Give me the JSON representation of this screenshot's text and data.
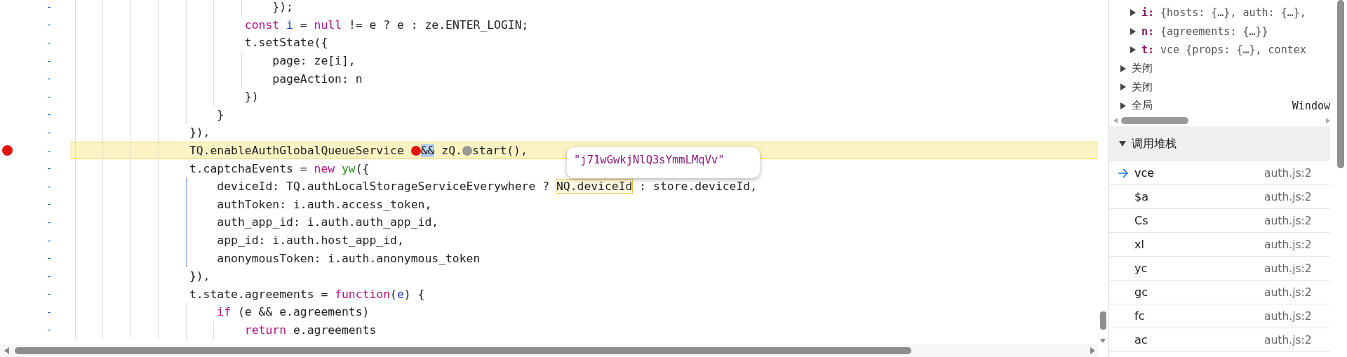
{
  "code": {
    "lines": [
      {
        "gutter": "-",
        "breakpoint": false,
        "paused": false,
        "active_guide": false,
        "tokens": [
          {
            "t": "                            });",
            "kind": "plain"
          }
        ]
      },
      {
        "gutter": "-",
        "breakpoint": false,
        "paused": false,
        "active_guide": false,
        "tokens": [
          {
            "t": "                        const",
            "kind": "keyword"
          },
          {
            "t": " i",
            "kind": "def"
          },
          {
            "t": " = ",
            "kind": "plain"
          },
          {
            "t": "null",
            "kind": "keyword"
          },
          {
            "t": " != e ? e : ze.ENTER_LOGIN;",
            "kind": "plain"
          }
        ]
      },
      {
        "gutter": "-",
        "breakpoint": false,
        "paused": false,
        "active_guide": false,
        "tokens": [
          {
            "t": "                        t.setState({",
            "kind": "plain"
          }
        ]
      },
      {
        "gutter": "-",
        "breakpoint": false,
        "paused": false,
        "active_guide": false,
        "tokens": [
          {
            "t": "                            page: ze[i],",
            "kind": "plain"
          }
        ]
      },
      {
        "gutter": "-",
        "breakpoint": false,
        "paused": false,
        "active_guide": false,
        "tokens": [
          {
            "t": "                            pageAction: n",
            "kind": "plain"
          }
        ]
      },
      {
        "gutter": "-",
        "breakpoint": false,
        "paused": false,
        "active_guide": false,
        "tokens": [
          {
            "t": "                        })",
            "kind": "plain"
          }
        ]
      },
      {
        "gutter": "-",
        "breakpoint": false,
        "paused": false,
        "active_guide": false,
        "tokens": [
          {
            "t": "                    }",
            "kind": "plain"
          }
        ]
      },
      {
        "gutter": "-",
        "breakpoint": false,
        "paused": false,
        "active_guide": false,
        "tokens": [
          {
            "t": "                }),",
            "kind": "plain"
          }
        ]
      },
      {
        "gutter": "-",
        "breakpoint": true,
        "paused": true,
        "active_guide": false,
        "tokens": [
          {
            "t": "                TQ.enableAuthGlobalQueueService ",
            "kind": "plain"
          },
          {
            "kind": "marker",
            "active": true
          },
          {
            "t": "&&",
            "kind": "plain",
            "selected": true
          },
          {
            "t": " zQ.",
            "kind": "plain"
          },
          {
            "kind": "marker",
            "active": false
          },
          {
            "t": "start(),",
            "kind": "plain"
          }
        ]
      },
      {
        "gutter": "-",
        "breakpoint": false,
        "paused": false,
        "active_guide": false,
        "tokens": [
          {
            "t": "                t.captchaEvents = ",
            "kind": "plain"
          },
          {
            "t": "new",
            "kind": "keyword"
          },
          {
            "t": " yw",
            "kind": "call"
          },
          {
            "t": "({",
            "kind": "plain"
          }
        ]
      },
      {
        "gutter": "-",
        "breakpoint": false,
        "paused": false,
        "active_guide": true,
        "tokens": [
          {
            "t": "                    deviceId: TQ.authLocalStorageServiceEverywhere ? ",
            "kind": "plain"
          },
          {
            "t": "NQ.deviceId",
            "kind": "plain",
            "hovered": true
          },
          {
            "t": " : store.deviceId,",
            "kind": "plain"
          }
        ]
      },
      {
        "gutter": "-",
        "breakpoint": false,
        "paused": false,
        "active_guide": true,
        "tokens": [
          {
            "t": "                    authToken: i.auth.access_token,",
            "kind": "plain"
          }
        ]
      },
      {
        "gutter": "-",
        "breakpoint": false,
        "paused": false,
        "active_guide": true,
        "tokens": [
          {
            "t": "                    auth_app_id: i.auth.auth_app_id,",
            "kind": "plain"
          }
        ]
      },
      {
        "gutter": "-",
        "breakpoint": false,
        "paused": false,
        "active_guide": true,
        "tokens": [
          {
            "t": "                    app_id: i.auth.host_app_id,",
            "kind": "plain"
          }
        ]
      },
      {
        "gutter": "-",
        "breakpoint": false,
        "paused": false,
        "active_guide": true,
        "tokens": [
          {
            "t": "                    anonymousToken: i.auth.anonymous_token",
            "kind": "plain"
          }
        ]
      },
      {
        "gutter": "-",
        "breakpoint": false,
        "paused": false,
        "active_guide": false,
        "tokens": [
          {
            "t": "                }),",
            "kind": "plain"
          }
        ]
      },
      {
        "gutter": "-",
        "breakpoint": false,
        "paused": false,
        "active_guide": false,
        "tokens": [
          {
            "t": "                t.state.agreements = ",
            "kind": "plain"
          },
          {
            "t": "function",
            "kind": "keyword"
          },
          {
            "t": "(",
            "kind": "plain"
          },
          {
            "t": "e",
            "kind": "def"
          },
          {
            "t": ") {",
            "kind": "plain"
          }
        ]
      },
      {
        "gutter": "-",
        "breakpoint": false,
        "paused": false,
        "active_guide": false,
        "tokens": [
          {
            "t": "                    if",
            "kind": "keyword"
          },
          {
            "t": " (e && e.agreements)",
            "kind": "plain"
          }
        ]
      },
      {
        "gutter": "-",
        "breakpoint": false,
        "paused": false,
        "active_guide": false,
        "tokens": [
          {
            "t": "                        return",
            "kind": "keyword"
          },
          {
            "t": " e.agreements",
            "kind": "plain"
          }
        ]
      }
    ],
    "tooltip": "\"j71wGwkjNlQ3sYmmLMqVv\""
  },
  "scope": {
    "variables": [
      {
        "name": "i:",
        "value": "{hosts: {…}, auth: {…},",
        "expanded": false
      },
      {
        "name": "n:",
        "value": "{agreements: {…}}",
        "expanded": false
      },
      {
        "name": "t:",
        "value": "vce {props: {…}, contex",
        "expanded": false
      }
    ],
    "sections": [
      {
        "label": "关闭",
        "expanded": false
      },
      {
        "label": "关闭",
        "expanded": false
      },
      {
        "label": "全局",
        "value": "Window",
        "expanded": false
      }
    ]
  },
  "call_stack": {
    "title": "调用堆栈",
    "expanded": true,
    "frames": [
      {
        "name": "vce",
        "location": "auth.js:2",
        "selected": true
      },
      {
        "name": "$a",
        "location": "auth.js:2",
        "selected": false
      },
      {
        "name": "Cs",
        "location": "auth.js:2",
        "selected": false
      },
      {
        "name": "xl",
        "location": "auth.js:2",
        "selected": false
      },
      {
        "name": "yc",
        "location": "auth.js:2",
        "selected": false
      },
      {
        "name": "gc",
        "location": "auth.js:2",
        "selected": false
      },
      {
        "name": "fc",
        "location": "auth.js:2",
        "selected": false
      },
      {
        "name": "ac",
        "location": "auth.js:2",
        "selected": false
      }
    ]
  }
}
